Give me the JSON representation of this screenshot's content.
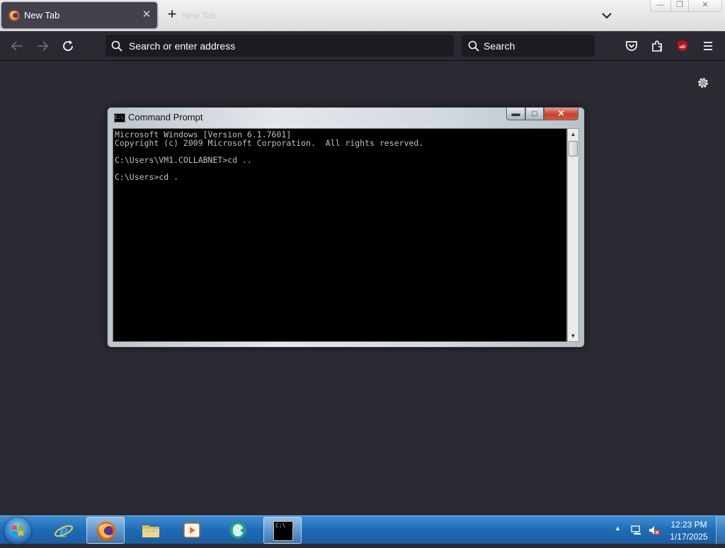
{
  "browser": {
    "tab": {
      "title": "New Tab",
      "icon": "firefox-icon",
      "close_icon": "close-icon"
    },
    "new_tab_icon": "plus-icon",
    "ghost_tab_label": "New Tab",
    "list_all_tabs_icon": "chevron-down-icon",
    "window_controls": {
      "minimize": "minimize-icon",
      "maximize": "maximize-icon",
      "close": "close-icon"
    },
    "nav": {
      "back": "back-arrow-icon",
      "forward": "forward-arrow-icon",
      "reload": "reload-icon"
    },
    "urlbar": {
      "placeholder": "Search or enter address",
      "icon": "search-icon"
    },
    "searchbar": {
      "placeholder": "Search",
      "icon": "search-icon"
    },
    "toolbar_icons": [
      "pocket-icon",
      "extensions-icon",
      "ublock-icon",
      "menu-icon"
    ],
    "ublock_label": "uD",
    "settings_icon": "gear-icon"
  },
  "cmd_window": {
    "title": "Command Prompt",
    "icon_label": "C:\\",
    "lines": [
      "Microsoft Windows [Version 6.1.7601]",
      "Copyright (c) 2009 Microsoft Corporation.  All rights reserved.",
      "",
      "C:\\Users\\VM1.COLLABNET>cd ..",
      "",
      "C:\\Users>cd ."
    ],
    "scroll_up": "▲",
    "scroll_down": "▼"
  },
  "taskbar": {
    "start": "windows-start-icon",
    "apps": [
      "internet-explorer-icon",
      "firefox-icon",
      "file-explorer-icon",
      "media-player-icon",
      "app-icon",
      "command-prompt-icon"
    ],
    "cmd_icon_label": "C:\\",
    "tray": {
      "arrow": "▲",
      "network": "network-icon",
      "volume": "volume-muted-icon"
    },
    "clock": {
      "time": "12:23 PM",
      "date": "1/17/2025"
    }
  },
  "colors": {
    "browser_bg": "#2b2a33",
    "urlbar_bg": "#1c1b22",
    "console_bg": "#000000",
    "console_text": "#c0c0c0",
    "taskbar": "#1f6bb5"
  }
}
